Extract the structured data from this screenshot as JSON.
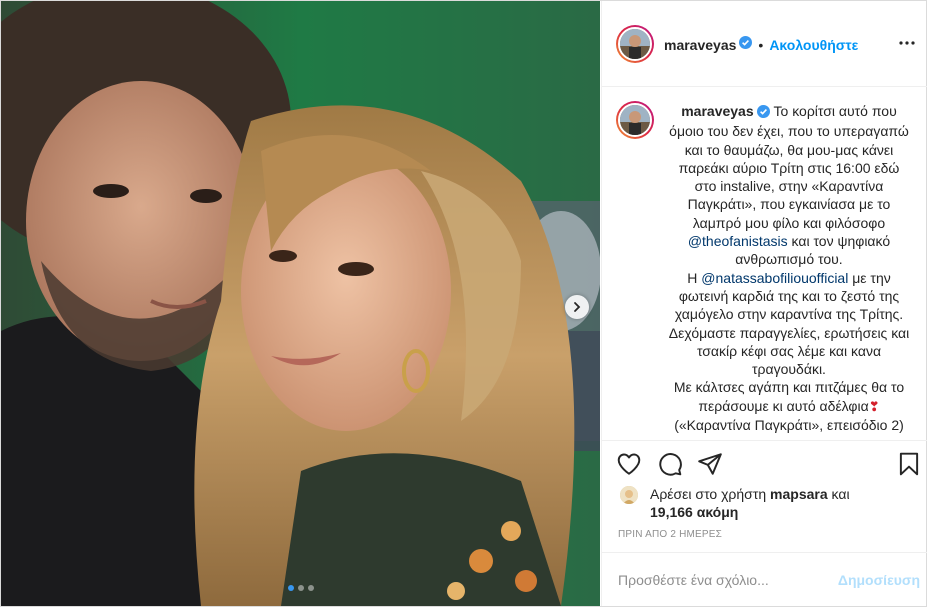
{
  "post": {
    "username": "maraveyas",
    "verified": true,
    "follow_label": "Ακολουθήστε",
    "header_separator": "•",
    "more_icon": "more-horizontal-icon",
    "caption": {
      "line1": "Το κορίτσι αυτό που όμοιο του δεν έχει, που το υπεραγαπώ και το θαυμάζω, θα μου-μας κάνει παρεάκι αύριο Τρίτη στις 16:00 εδώ στο instalive, στην «Καραντίνα Παγκράτι», που εγκαινίασα με το λαμπρό μου φίλο και φιλόσοφο",
      "mention1": "@theofanistasis",
      "line2": "και τον ψηφιακό ανθρωπισμό του.",
      "line3_prefix": "Η",
      "mention2": "@natassabofiliouofficial",
      "line3": "με την φωτεινή καρδιά της και το ζεστό της χαμόγελο στην καραντίνα της Τρίτης. Δεχόμαστε παραγγελίες, ερωτήσεις και τσακίρ κέφι σας λέμε και κανα τραγουδάκι.",
      "line4": "Με κάλτσες αγάπη και πιτζάμες θα το περάσουμε κι αυτό αδέλφια",
      "emoji": "❣",
      "line5": "(«Καραντίνα Παγκράτι», επεισόδιο 2)"
    },
    "likes": {
      "prefix": "Αρέσει στο χρήστη",
      "user": "mapsara",
      "middle": "και",
      "count": "19,166 ακόμη"
    },
    "time_ago": "ΠΡΙΝ ΑΠΟ 2 ΗΜΕΡΕΣ",
    "comment": {
      "placeholder": "Προσθέστε ένα σχόλιο...",
      "value": "",
      "post_label": "Δημοσίευση"
    },
    "carousel": {
      "count": 3,
      "active_index": 0
    }
  },
  "colors": {
    "link": "#0095f6",
    "mention": "#00376b",
    "muted": "#8e8e8e",
    "post_disabled": "#b2dffc",
    "border": "#dbdbdb",
    "active_dot": "#3897f0"
  },
  "icons": [
    "heart-icon",
    "comment-icon",
    "share-icon",
    "bookmark-icon",
    "chevron-right-icon",
    "verified-icon"
  ]
}
